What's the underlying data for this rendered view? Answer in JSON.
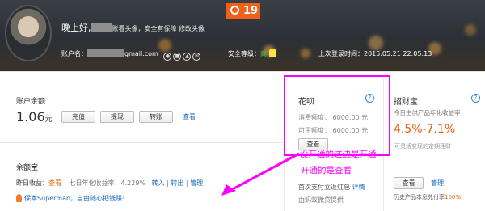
{
  "header": {
    "greeting": "晚上好,",
    "greeting_links": "账看头像，安全有保障 修改头像",
    "account_label": "账户名：",
    "account_email_suffix": "gmail.com",
    "security_label": "安全等级：",
    "security_level": "高",
    "last_login_label": "上次登录时间：",
    "last_login_time": "2015.05.21 22:05:13",
    "badge_count": "19"
  },
  "balance": {
    "title": "账户余额",
    "amount": "1.06",
    "unit": "元",
    "buttons": [
      "充值",
      "提现",
      "转账"
    ],
    "view_link": "查看"
  },
  "yuebao": {
    "title": "余额宝",
    "yesterday_label": "昨日收益：",
    "yesterday_link": "查看",
    "rate_label": "七日年化收益率：4.229%",
    "actions": [
      "转入",
      "转出",
      "管理"
    ],
    "promo": "保本Superman，自由随心把钱赚！"
  },
  "huabei": {
    "title": "花呗",
    "consumed": "消费额度： 6000.00 元",
    "available": "可用额度： 6000.00 元",
    "view_button": "查看",
    "note1": "首次支付立返红包",
    "note1_link": "详情",
    "note2": "由蚂蚁微贷提供"
  },
  "zhaocaibao": {
    "title": "招财宝",
    "subtitle": "今日主供产品年化收益率：",
    "rate": "4.5%-7.1%",
    "fund_note": "可灵活变现的定期理财",
    "view_button": "查看",
    "manage_link": "管理",
    "history_note": "历史产品本息兑付率",
    "history_rate": "100%"
  },
  "annotation": {
    "line1": "没开通的这边是开通",
    "line2": "开通的是查看",
    "color": "#ff00ff"
  }
}
